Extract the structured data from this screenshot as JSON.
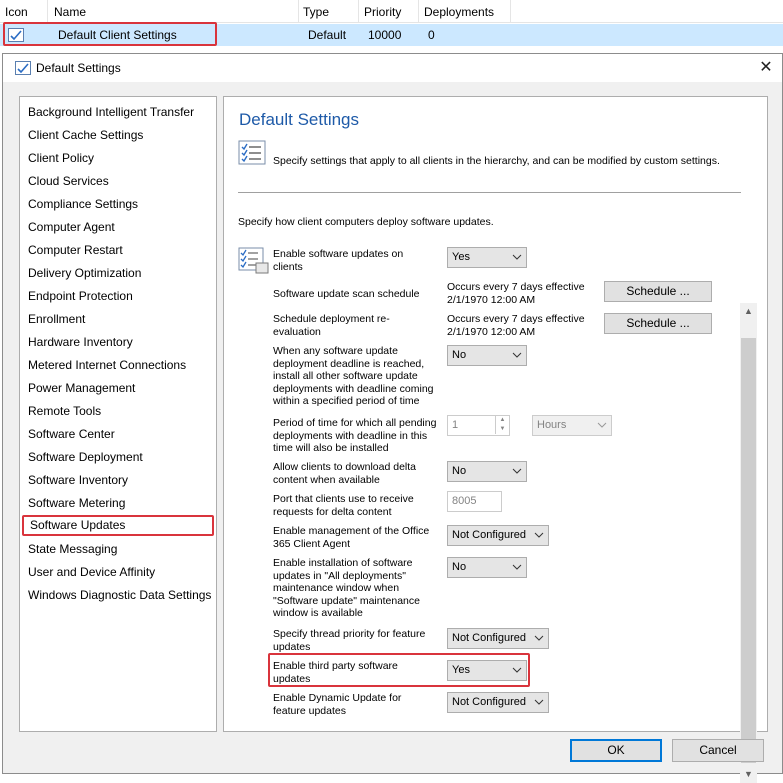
{
  "list": {
    "columns": [
      "Icon",
      "Name",
      "Type",
      "Priority",
      "Deployments"
    ],
    "row": {
      "name": "Default Client Settings",
      "type": "Default",
      "priority": "10000",
      "deployments": "0"
    }
  },
  "dialog": {
    "title": "Default Settings",
    "close_glyph": "✕",
    "nav": [
      "Background Intelligent Transfer",
      "Client Cache Settings",
      "Client Policy",
      "Cloud Services",
      "Compliance Settings",
      "Computer Agent",
      "Computer Restart",
      "Delivery Optimization",
      "Endpoint Protection",
      "Enrollment",
      "Hardware Inventory",
      "Metered Internet Connections",
      "Power Management",
      "Remote Tools",
      "Software Center",
      "Software Deployment",
      "Software Inventory",
      "Software Metering",
      "Software Updates",
      "State Messaging",
      "User and Device Affinity",
      "Windows Diagnostic Data Settings"
    ],
    "selected_nav": "Software Updates",
    "content": {
      "heading": "Default Settings",
      "description": "Specify settings that apply to all clients in the hierarchy, and can be modified by custom settings.",
      "subdescription": "Specify how client computers deploy software updates.",
      "settings": {
        "enable_updates": {
          "label": "Enable software updates on clients",
          "value": "Yes"
        },
        "scan_schedule": {
          "label": "Software update scan schedule",
          "value": "Occurs every 7 days effective 2/1/1970 12:00 AM",
          "button": "Schedule ..."
        },
        "reeval_schedule": {
          "label": "Schedule deployment re-evaluation",
          "value": "Occurs every 7 days effective 2/1/1970 12:00 AM",
          "button": "Schedule ..."
        },
        "deadline_install": {
          "label": "When any software update deployment deadline is reached, install all other software update deployments with deadline coming within a specified period of time",
          "value": "No"
        },
        "period": {
          "label": "Period of time for which all pending deployments with deadline in this time will also be installed",
          "value": "1",
          "unit": "Hours"
        },
        "delta_download": {
          "label": "Allow clients to download delta content when available",
          "value": "No"
        },
        "delta_port": {
          "label": "Port that clients use to receive requests for delta content",
          "value": "8005"
        },
        "o365": {
          "label": "Enable management of the Office 365 Client Agent",
          "value": "Not Configured"
        },
        "all_deployments_window": {
          "label": "Enable installation of software updates in \"All deployments\" maintenance window when \"Software update\" maintenance window is available",
          "value": "No"
        },
        "thread_priority": {
          "label": "Specify thread priority for feature updates",
          "value": "Not Configured"
        },
        "third_party": {
          "label": "Enable third party software updates",
          "value": "Yes"
        },
        "dynamic_update": {
          "label": "Enable Dynamic Update for feature updates",
          "value": "Not Configured"
        }
      }
    },
    "buttons": {
      "ok": "OK",
      "cancel": "Cancel"
    }
  },
  "colors": {
    "accent_red": "#d9343c",
    "heading_blue": "#1e5aa8",
    "selection_blue": "#cce8ff",
    "focus_blue": "#0078d7"
  }
}
